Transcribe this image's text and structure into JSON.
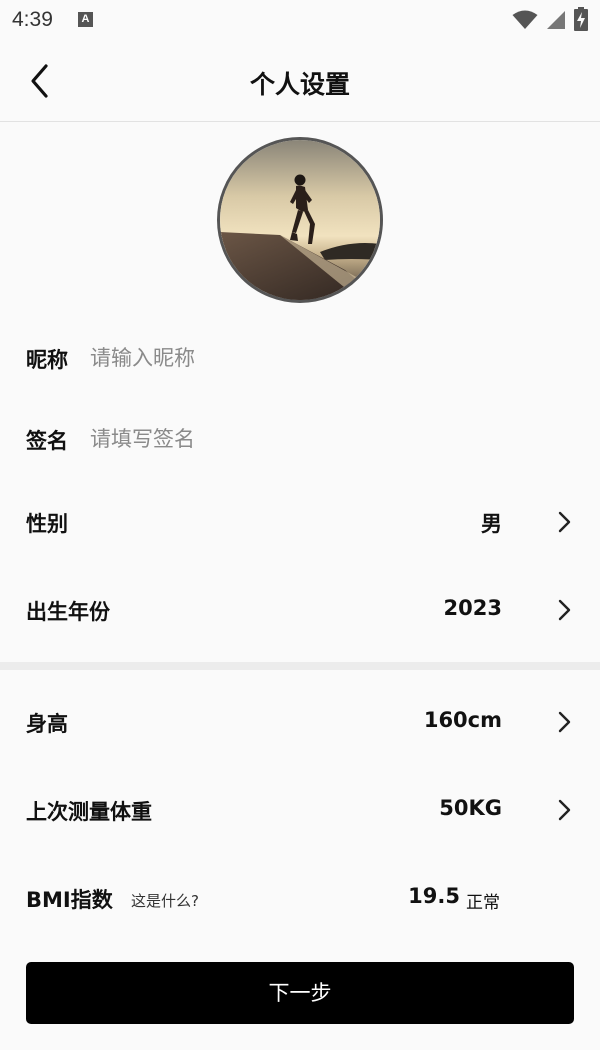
{
  "status_bar": {
    "time": "4:39",
    "notification_badge": "A",
    "icons": [
      "wifi-icon",
      "cell-signal-icon",
      "battery-charging-icon"
    ]
  },
  "header": {
    "title": "个人设置",
    "back_icon": "chevron-left-icon"
  },
  "avatar": {
    "description": "runner-photo"
  },
  "form": {
    "nickname": {
      "label": "昵称",
      "placeholder": "请输入昵称",
      "value": ""
    },
    "signature": {
      "label": "签名",
      "placeholder": "请填写签名",
      "value": ""
    },
    "gender": {
      "label": "性别",
      "value": "男"
    },
    "birth_year": {
      "label": "出生年份",
      "value": "2023"
    },
    "height": {
      "label": "身高",
      "value": "160cm"
    },
    "weight": {
      "label": "上次测量体重",
      "value": "50KG"
    },
    "bmi": {
      "label": "BMI指数",
      "hint": "这是什么?",
      "value": "19.5",
      "status": "正常"
    }
  },
  "actions": {
    "next_label": "下一步"
  },
  "colors": {
    "background": "#fafafa",
    "primary_button": "#000000",
    "divider": "#ececec",
    "placeholder": "#8a8a8a"
  }
}
